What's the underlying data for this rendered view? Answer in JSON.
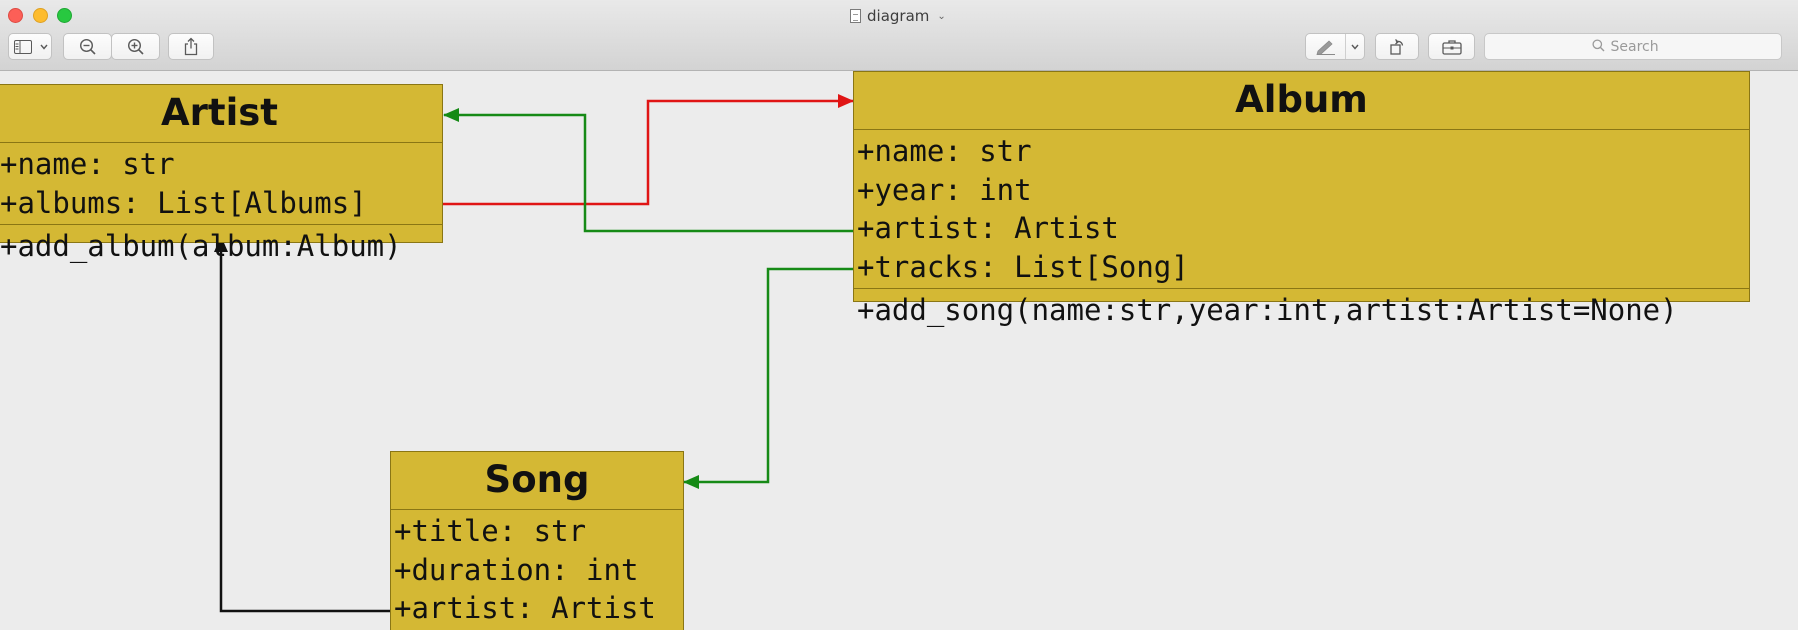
{
  "window": {
    "title": "diagram",
    "search_placeholder": "Search"
  },
  "diagram": {
    "classes": {
      "artist": {
        "name": "Artist",
        "attributes": [
          "+name: str",
          "+albums: List[Albums]"
        ],
        "methods": [
          "+add_album(album:Album)"
        ]
      },
      "album": {
        "name": "Album",
        "attributes": [
          "+name: str",
          "+year: int",
          "+artist: Artist",
          "+tracks: List[Song]"
        ],
        "methods": [
          "+add_song(name:str,year:int,artist:Artist=None)"
        ]
      },
      "song": {
        "name": "Song",
        "attributes": [
          "+title: str",
          "+duration: int",
          "+artist: Artist"
        ],
        "methods": []
      }
    },
    "colors": {
      "class_fill": "#d4b834",
      "class_border": "#8a7614",
      "link_albums": "#e01515",
      "link_artist": "#168a16",
      "link_tracks": "#168a16",
      "link_song_artist": "#111111"
    },
    "links": [
      {
        "from": "Artist.albums",
        "to": "Album",
        "color": "red"
      },
      {
        "from": "Album.artist",
        "to": "Artist",
        "color": "green"
      },
      {
        "from": "Album.tracks",
        "to": "Song",
        "color": "green"
      },
      {
        "from": "Song.artist",
        "to": "Artist",
        "color": "black"
      }
    ]
  }
}
